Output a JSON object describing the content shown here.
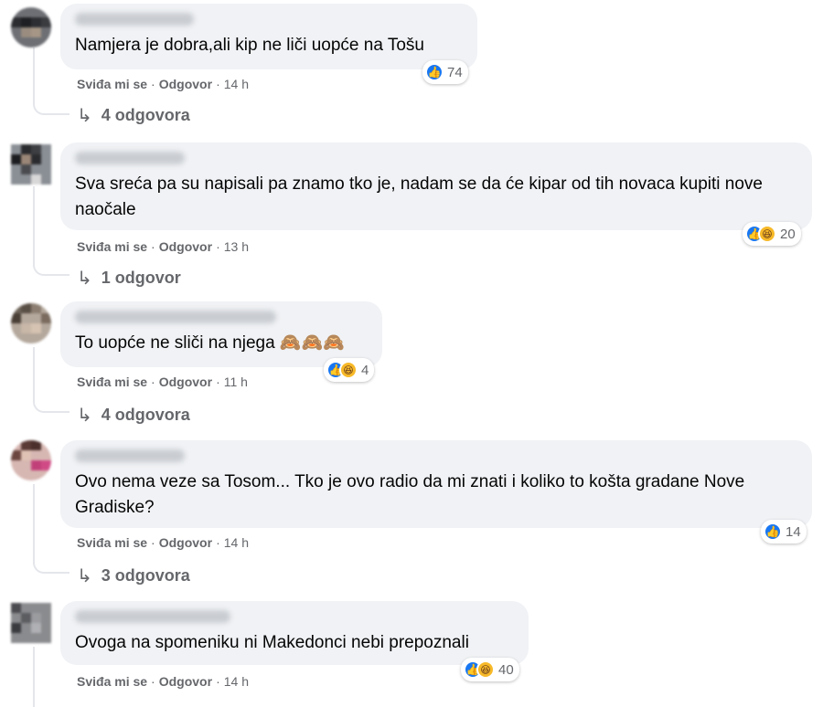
{
  "comments": [
    {
      "text": "Namjera je dobra,ali kip ne liči uopće na Tošu",
      "reactions": [
        "like"
      ],
      "reaction_count": "74",
      "like": "Sviđa mi se",
      "reply": "Odgovor",
      "time": "14 h",
      "replies": "4 odgovora"
    },
    {
      "text": "Sva sreća pa su napisali pa znamo tko je, nadam se da će kipar od tih novaca kupiti nove naočale",
      "reactions": [
        "like",
        "haha"
      ],
      "reaction_count": "20",
      "like": "Sviđa mi se",
      "reply": "Odgovor",
      "time": "13 h",
      "replies": "1 odgovor"
    },
    {
      "text": "To uopće ne sliči na njega 🙈🙈🙈",
      "reactions": [
        "like",
        "haha"
      ],
      "reaction_count": "4",
      "like": "Sviđa mi se",
      "reply": "Odgovor",
      "time": "11 h",
      "replies": "4 odgovora"
    },
    {
      "text": "Ovo nema veze sa Tosom... Tko je ovo radio da mi znati i koliko to košta gradane Nove Gradiske?",
      "reactions": [
        "like"
      ],
      "reaction_count": "14",
      "like": "Sviđa mi se",
      "reply": "Odgovor",
      "time": "14 h",
      "replies": "3 odgovora"
    },
    {
      "text": "Ovoga na spomeniku ni Makedonci nebi prepoznali",
      "reactions": [
        "like",
        "haha"
      ],
      "reaction_count": "40",
      "like": "Sviđa mi se",
      "reply": "Odgovor",
      "time": "14 h",
      "replies": ""
    }
  ],
  "colors": {
    "bubble": "#f0f2f5",
    "like_blue": "#1877f2",
    "haha_yellow": "#f7b928",
    "meta_gray": "#65676b"
  }
}
